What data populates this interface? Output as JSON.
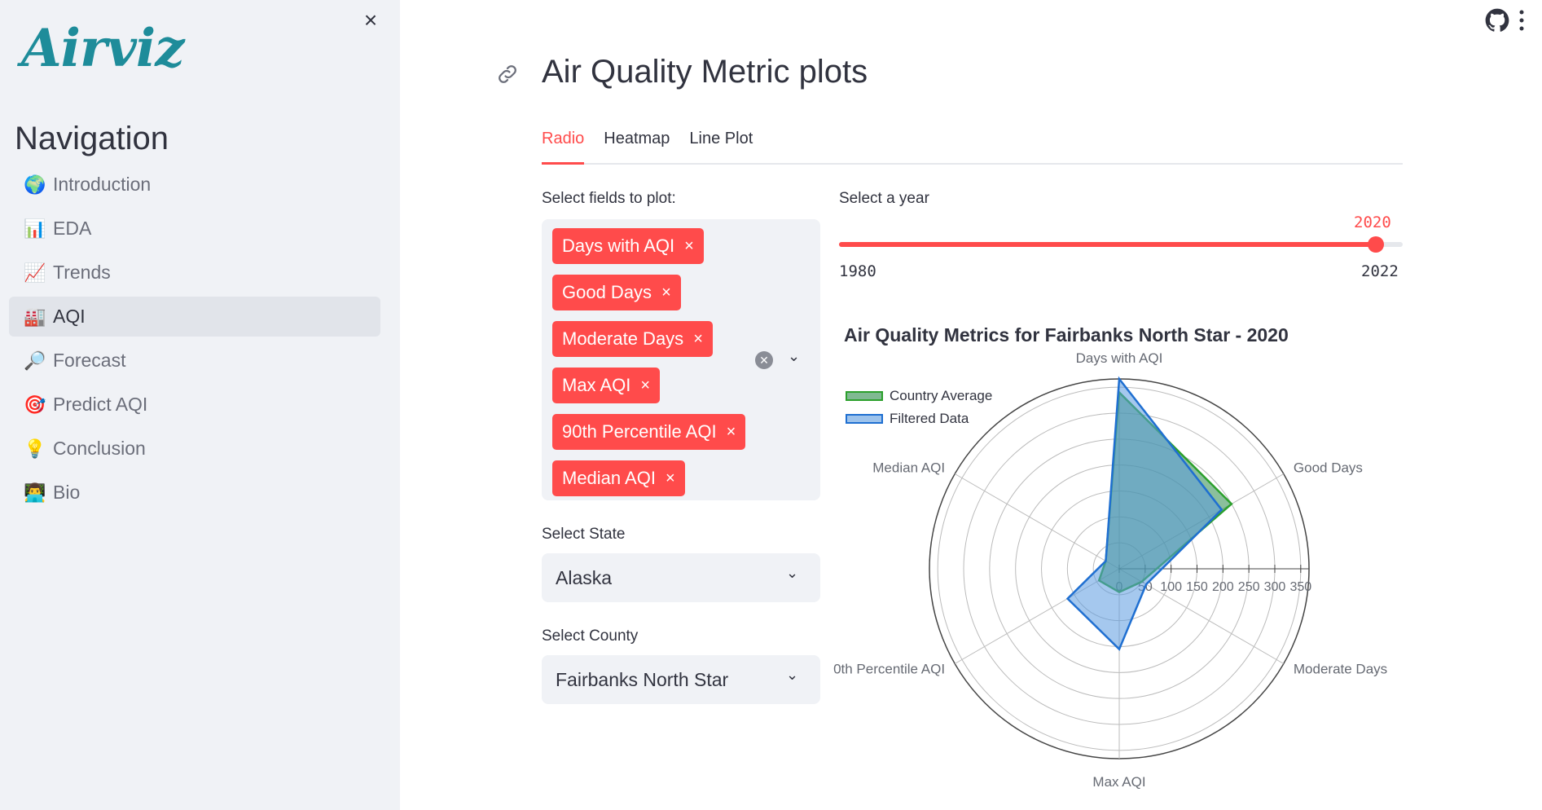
{
  "sidebar": {
    "logo": "Airviz",
    "nav_title": "Navigation",
    "items": [
      {
        "label": "Introduction",
        "icon": "🌍"
      },
      {
        "label": "EDA",
        "icon": "📊"
      },
      {
        "label": "Trends",
        "icon": "📈"
      },
      {
        "label": "AQI",
        "icon": "🏭"
      },
      {
        "label": "Forecast",
        "icon": "🔎"
      },
      {
        "label": "Predict AQI",
        "icon": "🎯"
      },
      {
        "label": "Conclusion",
        "icon": "💡"
      },
      {
        "label": "Bio",
        "icon": "👨‍💻"
      }
    ],
    "active_index": 3,
    "close_icon": "×"
  },
  "header": {
    "title": "Air Quality Metric plots"
  },
  "tabs": [
    {
      "label": "Radio"
    },
    {
      "label": "Heatmap"
    },
    {
      "label": "Line Plot"
    }
  ],
  "fields": {
    "label": "Select fields to plot:",
    "selected": [
      "Days with AQI",
      "Good Days",
      "Moderate Days",
      "Max AQI",
      "90th Percentile AQI",
      "Median AQI"
    ],
    "remove_glyph": "×"
  },
  "state": {
    "label": "Select State",
    "value": "Alaska"
  },
  "county": {
    "label": "Select County",
    "value": "Fairbanks North Star"
  },
  "year": {
    "label": "Select a year",
    "value": "2020",
    "min": "1980",
    "max": "2022",
    "fraction": 0.9524
  },
  "chart_data": {
    "type": "radar",
    "title": "Air Quality Metrics for Fairbanks North Star  - 2020",
    "axes": [
      "Days with AQI",
      "Good Days",
      "Moderate Days",
      "Max AQI",
      "0th Percentile AQI",
      "Median AQI"
    ],
    "radial_ticks": [
      0,
      50,
      100,
      150,
      200,
      250,
      300,
      350
    ],
    "radial_range": [
      0,
      366
    ],
    "legend_placement": "top-left",
    "series": [
      {
        "name": "Country Average",
        "color": "#2ca02c",
        "fill": "#2c8a4a",
        "values": [
          340,
          250,
          50,
          45,
          45,
          30
        ]
      },
      {
        "name": "Filtered Data",
        "color": "#1f6fd1",
        "fill": "#5b9be0",
        "values": [
          366,
          228,
          60,
          155,
          115,
          30
        ]
      }
    ]
  }
}
